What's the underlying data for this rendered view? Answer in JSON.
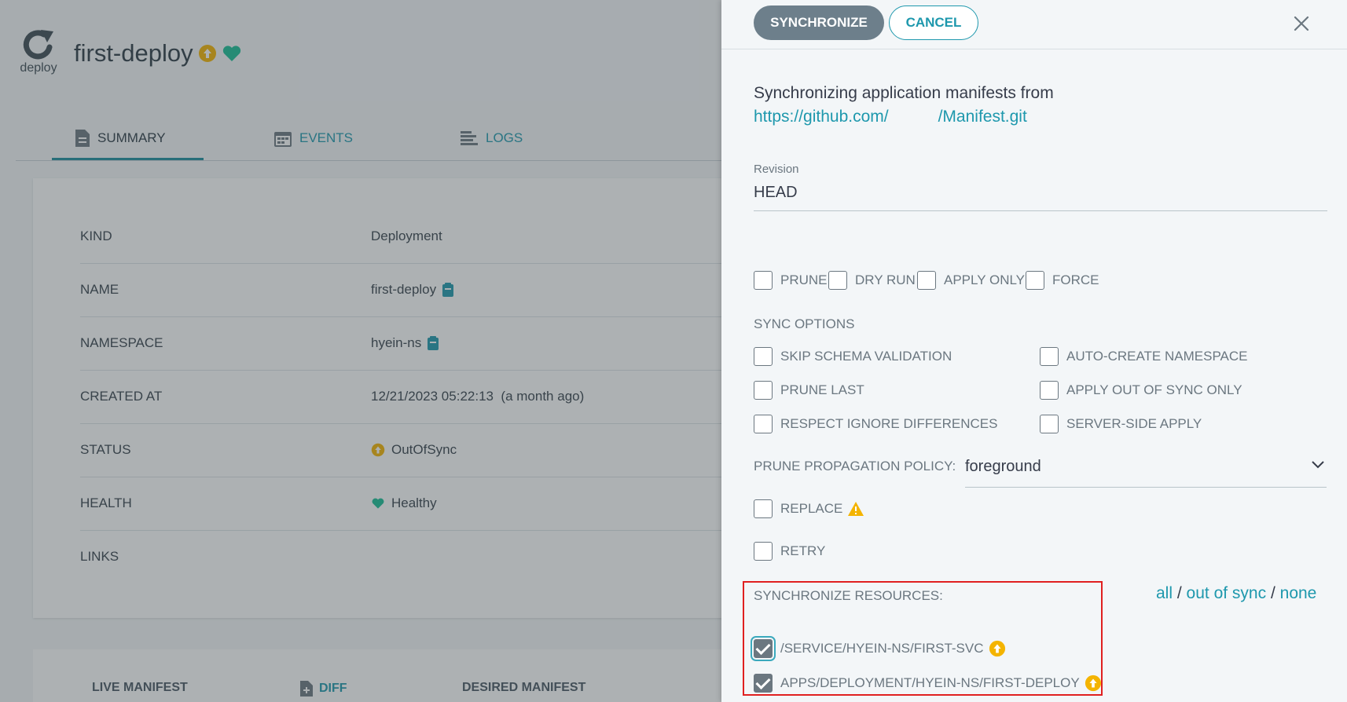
{
  "app": {
    "icon_label": "deploy",
    "name": "first-deploy",
    "colors": {
      "sync_badge": "#f4b400",
      "health": "#18be94",
      "accent": "#1e98ad"
    }
  },
  "tabs": [
    {
      "label": "SUMMARY",
      "icon": "document-icon",
      "active": true
    },
    {
      "label": "EVENTS",
      "icon": "calendar-icon",
      "active": false
    },
    {
      "label": "LOGS",
      "icon": "lines-icon",
      "active": false
    }
  ],
  "summary": {
    "rows": [
      {
        "key": "KIND",
        "value": "Deployment"
      },
      {
        "key": "NAME",
        "value": "first-deploy"
      },
      {
        "key": "NAMESPACE",
        "value": "hyein-ns"
      },
      {
        "key": "CREATED AT",
        "value": "12/21/2023 05:22:13  (a month ago)"
      },
      {
        "key": "STATUS",
        "value": "OutOfSync"
      },
      {
        "key": "HEALTH",
        "value": "Healthy"
      },
      {
        "key": "LINKS",
        "value": ""
      }
    ]
  },
  "manifest_tabs": {
    "live": "LIVE MANIFEST",
    "diff": "DIFF",
    "desired": "DESIRED MANIFEST"
  },
  "panel": {
    "synchronize_label": "SYNCHRONIZE",
    "cancel_label": "CANCEL",
    "intro": "Synchronizing application manifests from",
    "repo_prefix": "https://github.com/",
    "repo_suffix": "/Manifest.git",
    "revision_label": "Revision",
    "revision_value": "HEAD",
    "options": [
      {
        "label": "PRUNE",
        "checked": false
      },
      {
        "label": "DRY RUN",
        "checked": false
      },
      {
        "label": "APPLY ONLY",
        "checked": false
      },
      {
        "label": "FORCE",
        "checked": false
      }
    ],
    "sync_options_label": "SYNC OPTIONS",
    "sync_options_left": [
      {
        "label": "SKIP SCHEMA VALIDATION",
        "checked": false
      },
      {
        "label": "PRUNE LAST",
        "checked": false
      },
      {
        "label": "RESPECT IGNORE DIFFERENCES",
        "checked": false
      }
    ],
    "sync_options_right": [
      {
        "label": "AUTO-CREATE NAMESPACE",
        "checked": false
      },
      {
        "label": "APPLY OUT OF SYNC ONLY",
        "checked": false
      },
      {
        "label": "SERVER-SIDE APPLY",
        "checked": false
      }
    ],
    "prune_policy_label": "PRUNE PROPAGATION POLICY:",
    "prune_policy_value": "foreground",
    "replace_label": "REPLACE",
    "retry_label": "RETRY",
    "resources_label": "SYNCHRONIZE RESOURCES:",
    "select_all": "all",
    "select_out_of_sync": "out of sync",
    "select_none": "none",
    "separator": "/",
    "resources": [
      {
        "label": "/SERVICE/HYEIN-NS/FIRST-SVC",
        "checked": true,
        "status": "OutOfSync"
      },
      {
        "label": "APPS/DEPLOYMENT/HYEIN-NS/FIRST-DEPLOY",
        "checked": true,
        "status": "OutOfSync"
      }
    ],
    "warning_color": "#f4b400"
  }
}
